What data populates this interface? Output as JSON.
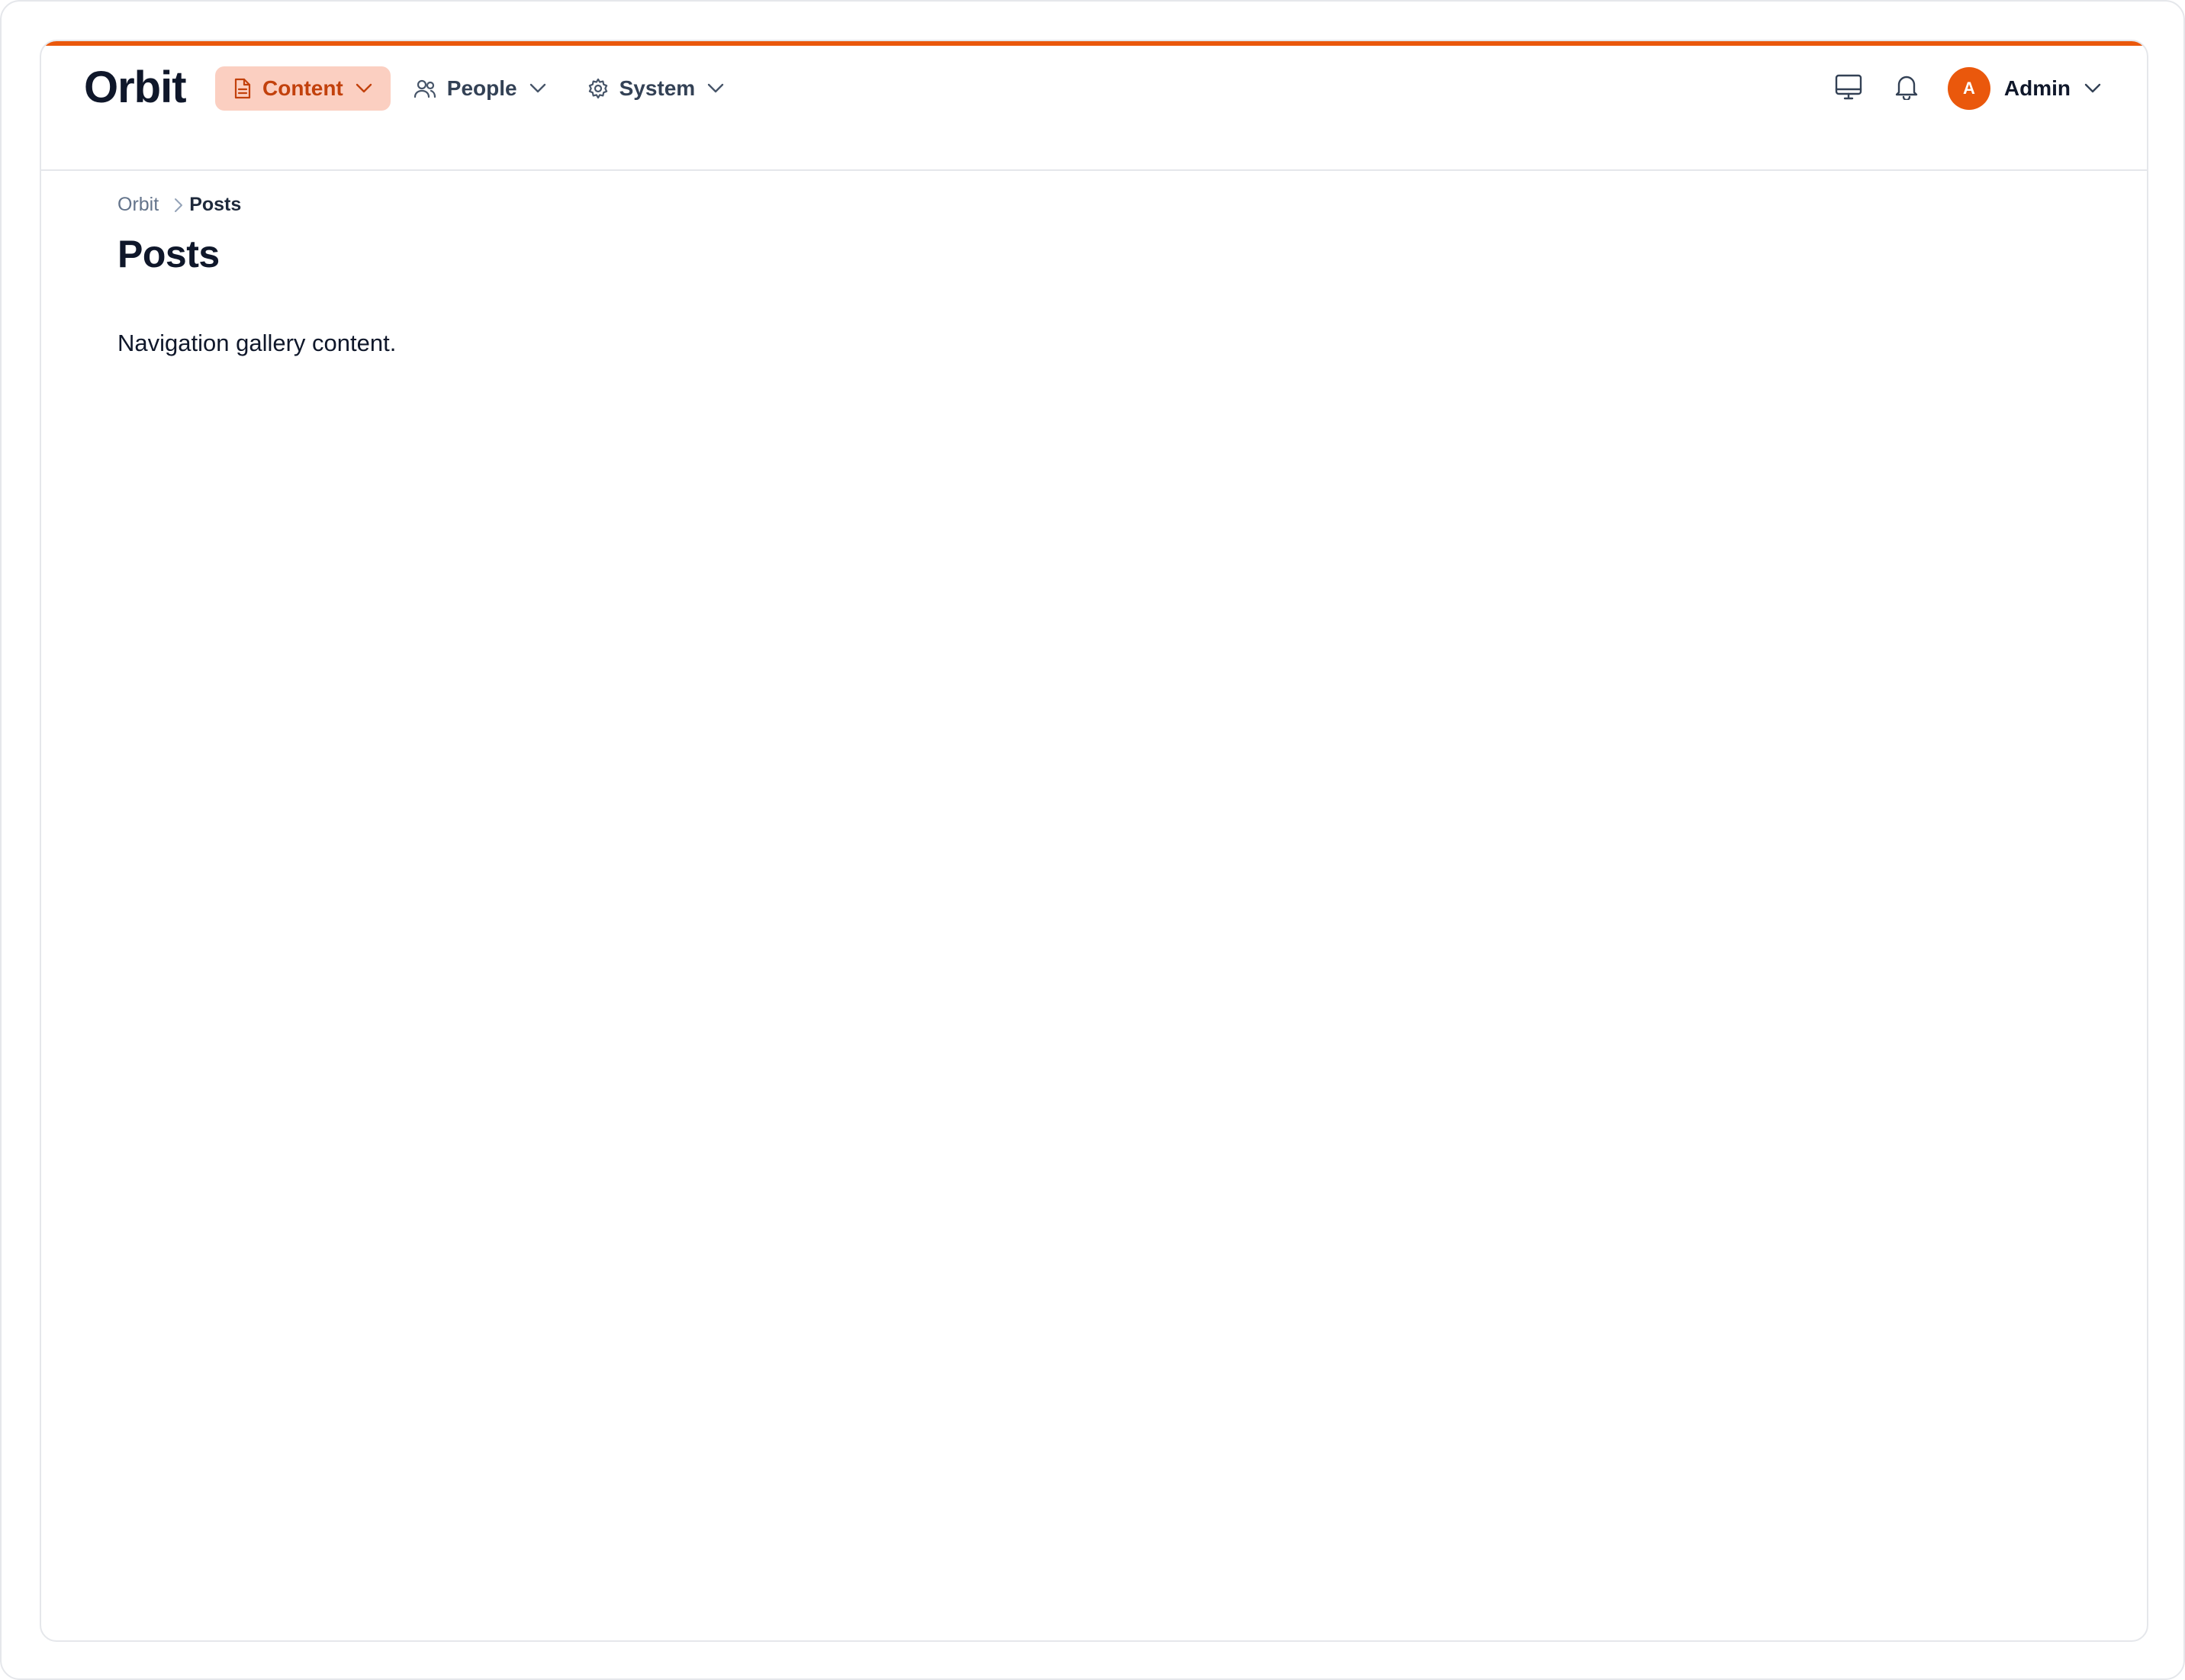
{
  "app": {
    "logo": "Orbit",
    "accent_color": "#ea580c"
  },
  "nav": {
    "items": [
      {
        "label": "Content",
        "icon": "document-icon",
        "active": true
      },
      {
        "label": "People",
        "icon": "users-icon",
        "active": false
      },
      {
        "label": "System",
        "icon": "gear-icon",
        "active": false
      }
    ]
  },
  "toolbar": {
    "display_icon": "monitor-icon",
    "notifications_icon": "bell-icon"
  },
  "user": {
    "avatar_initial": "A",
    "name": "Admin"
  },
  "breadcrumb": {
    "items": [
      "Orbit",
      "Posts"
    ]
  },
  "page": {
    "title": "Posts",
    "body": "Navigation gallery content."
  }
}
